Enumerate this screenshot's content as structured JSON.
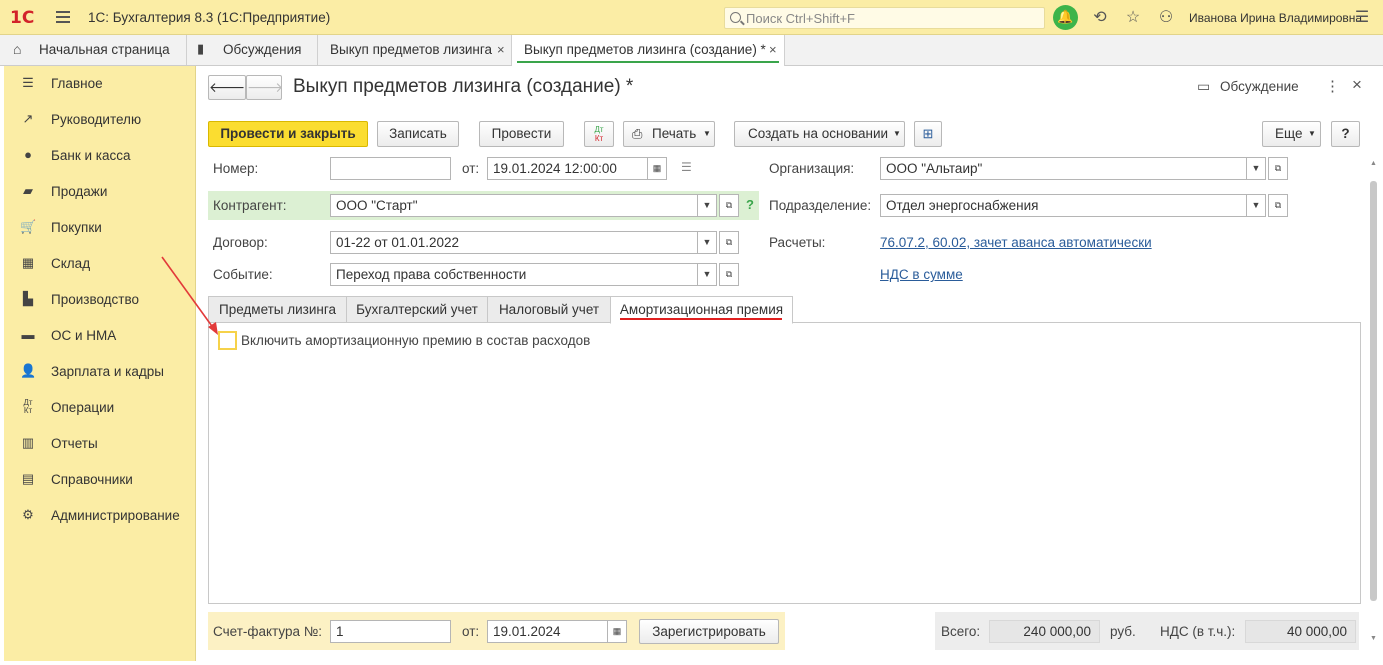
{
  "app": {
    "logo": "1С",
    "title": "1С: Бухгалтерия 8.3  (1С:Предприятие)",
    "search_placeholder": "Поиск Ctrl+Shift+F",
    "user": "Иванова Ирина Владимировна",
    "accent": "#3aa54b",
    "yellow": "#fbeda5"
  },
  "tabs": [
    {
      "label": "Начальная страница",
      "icon": "home-icon"
    },
    {
      "label": "Обсуждения",
      "icon": "chat-icon"
    },
    {
      "label": "Выкуп предметов лизинга",
      "closable": true
    },
    {
      "label": "Выкуп предметов лизинга (создание) *",
      "closable": true,
      "active": true
    }
  ],
  "sidebar": {
    "items": [
      {
        "label": "Главное",
        "icon": "menu-icon"
      },
      {
        "label": "Руководителю",
        "icon": "trend-icon"
      },
      {
        "label": "Банк и касса",
        "icon": "coin-icon"
      },
      {
        "label": "Продажи",
        "icon": "bag-icon"
      },
      {
        "label": "Покупки",
        "icon": "cart-icon"
      },
      {
        "label": "Склад",
        "icon": "grid-icon"
      },
      {
        "label": "Производство",
        "icon": "factory-icon"
      },
      {
        "label": "ОС и НМА",
        "icon": "truck-icon"
      },
      {
        "label": "Зарплата и кадры",
        "icon": "person-icon"
      },
      {
        "label": "Операции",
        "icon": "dt-kt-icon"
      },
      {
        "label": "Отчеты",
        "icon": "bars-icon"
      },
      {
        "label": "Справочники",
        "icon": "book-icon"
      },
      {
        "label": "Администрирование",
        "icon": "gear-icon"
      }
    ]
  },
  "doc": {
    "title": "Выкуп предметов лизинга (создание) *",
    "discussion": "Обсуждение",
    "toolbar": {
      "post_close": "Провести и закрыть",
      "save": "Записать",
      "post": "Провести",
      "dtkt_top": "Дт",
      "dtkt_bottom": "Кт",
      "print": "Печать",
      "create_based": "Создать на основании",
      "more": "Еще",
      "help": "?"
    },
    "fields": {
      "number_label": "Номер:",
      "number_value": "",
      "from_label": "от:",
      "date_value": "19.01.2024 12:00:00",
      "org_label": "Организация:",
      "org_value": "ООО \"Альтаир\"",
      "contractor_label": "Контрагент:",
      "contractor_value": "ООО \"Старт\"",
      "question": "?",
      "division_label": "Подразделение:",
      "division_value": "Отдел энергоснабжения",
      "contract_label": "Договор:",
      "contract_value": "01-22 от 01.01.2022",
      "settlements_label": "Расчеты:",
      "settlements_link": "76.07.2, 60.02, зачет аванса автоматически",
      "event_label": "Событие:",
      "event_value": "Переход права собственности",
      "vat_link": "НДС в сумме"
    },
    "form_tabs": [
      {
        "label": "Предметы лизинга"
      },
      {
        "label": "Бухгалтерский учет"
      },
      {
        "label": "Налоговый учет"
      },
      {
        "label": "Амортизационная премия",
        "active": true
      }
    ],
    "checkbox_label": "Включить амортизационную премию в состав расходов",
    "checkbox_checked": false,
    "footer": {
      "invoice_label": "Счет-фактура №:",
      "invoice_number": "1",
      "from_label": "от:",
      "invoice_date": "19.01.2024",
      "register": "Зарегистрировать",
      "total_label": "Всего:",
      "total_value": "240 000,00",
      "currency": "руб.",
      "vat_label": "НДС (в т.ч.):",
      "vat_value": "40 000,00"
    }
  }
}
